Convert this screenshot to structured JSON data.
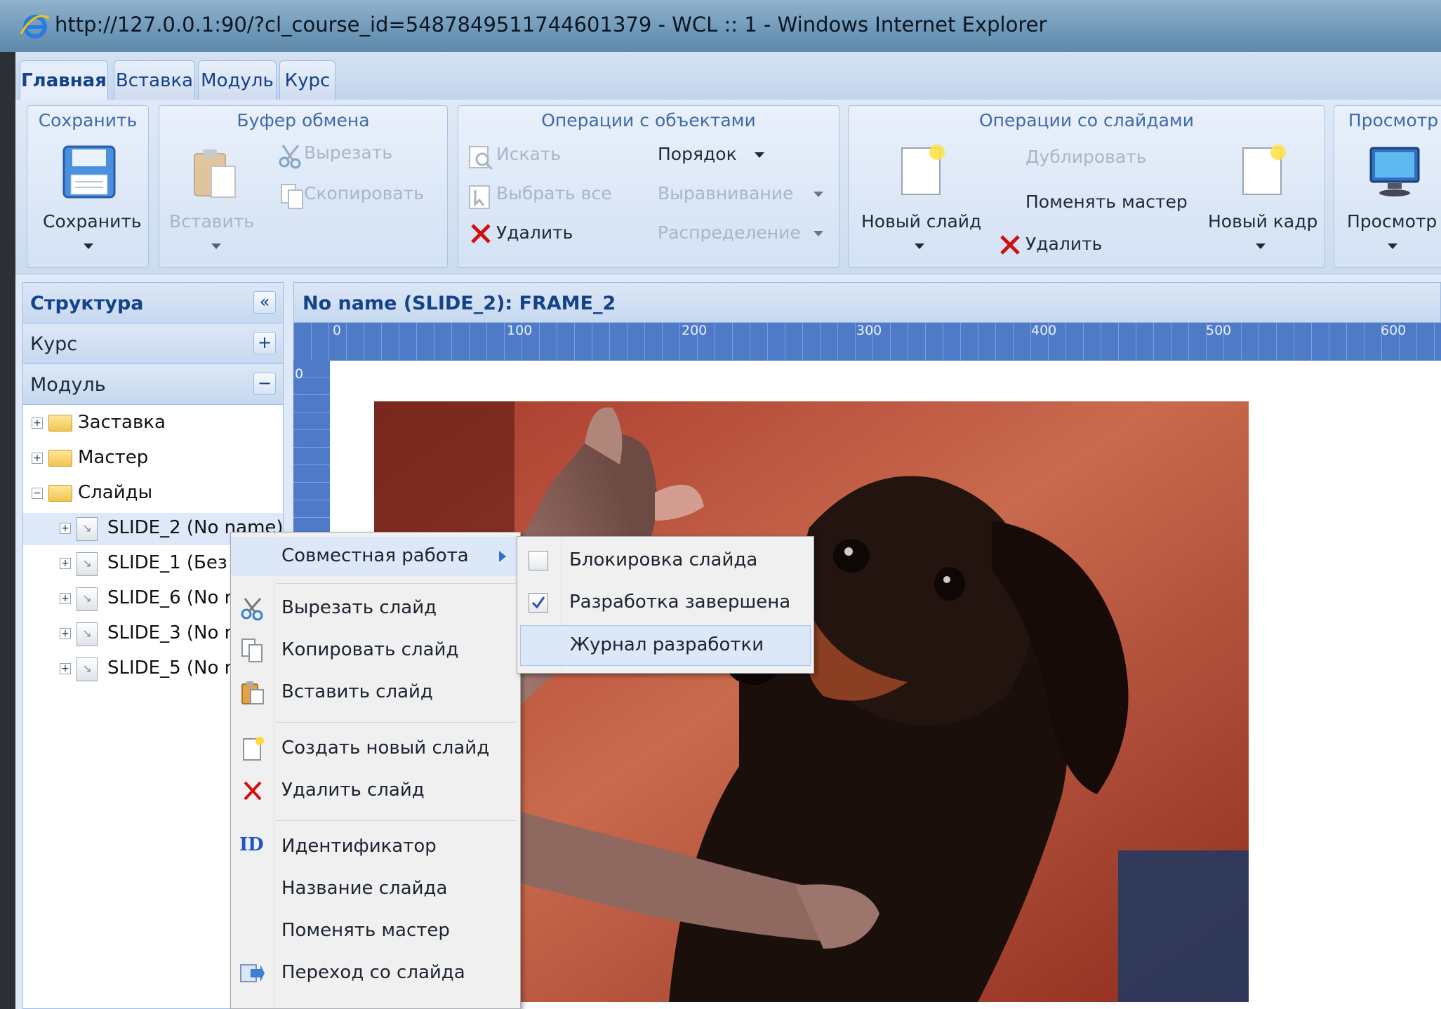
{
  "window": {
    "title": "http://127.0.0.1:90/?cl_course_id=5487849511744601379 - WCL :: 1 - Windows Internet Explorer"
  },
  "tabs": [
    "Главная",
    "Вставка",
    "Модуль",
    "Курс"
  ],
  "ribbon": {
    "save": {
      "header": "Сохранить",
      "button": "Сохранить"
    },
    "clipboard": {
      "header": "Буфер обмена",
      "paste": "Вставить",
      "cut": "Вырезать",
      "copy": "Скопировать"
    },
    "objects": {
      "header": "Операции с объектами",
      "find": "Искать",
      "select_all": "Выбрать все",
      "delete": "Удалить",
      "order": "Порядок",
      "align": "Выравнивание",
      "distribute": "Распределение"
    },
    "slides": {
      "header": "Операции со слайдами",
      "new_slide": "Новый слайд",
      "duplicate": "Дублировать",
      "change_master": "Поменять мастер",
      "delete": "Удалить",
      "new_frame": "Новый кадр"
    },
    "view": {
      "header": "Просмотр",
      "button": "Просмотр"
    }
  },
  "structure": {
    "title": "Структура",
    "collapse_glyph": "«",
    "course_label": "Курс",
    "module_label": "Модуль",
    "folders": [
      "Заставка",
      "Мастер",
      "Слайды"
    ],
    "slides": [
      "SLIDE_2 (No name)",
      "SLIDE_1 (Без",
      "SLIDE_6 (No n",
      "SLIDE_3 (No n",
      "SLIDE_5 (No n"
    ]
  },
  "main": {
    "header": "No name (SLIDE_2): FRAME_2",
    "ruler_h": [
      "0",
      "100",
      "200",
      "300",
      "400",
      "500",
      "600"
    ],
    "ruler_v": [
      "0"
    ]
  },
  "context_menu": {
    "items": [
      "Совместная работа",
      "Вырезать слайд",
      "Копировать слайд",
      "Вставить слайд",
      "Создать новый слайд",
      "Удалить слайд",
      "Идентификатор",
      "Название слайда",
      "Поменять мастер",
      "Переход со слайда"
    ],
    "id_icon_text": "ID"
  },
  "submenu": {
    "items": [
      {
        "label": "Блокировка слайда",
        "checked": false
      },
      {
        "label": "Разработка завершена",
        "checked": true
      },
      {
        "label": "Журнал разработки"
      }
    ]
  },
  "colors": {
    "accent": "#15428b",
    "ribbon_bg": "#dfe9f7",
    "ruler": "#4e7ac7",
    "delete_red": "#d01010"
  }
}
